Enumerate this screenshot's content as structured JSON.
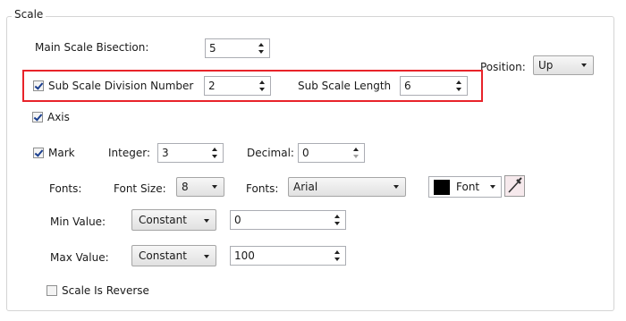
{
  "group": {
    "title": "Scale"
  },
  "main_scale": {
    "label": "Main Scale Bisection:",
    "value": "5"
  },
  "position": {
    "label": "Position:",
    "value": "Up"
  },
  "sub_scale": {
    "label": "Sub Scale Division Number",
    "value": "2",
    "checked": true
  },
  "sub_length": {
    "label": "Sub Scale Length",
    "value": "6"
  },
  "axis": {
    "label": "Axis",
    "checked": true
  },
  "mark": {
    "label": "Mark",
    "checked": true,
    "integer_label": "Integer:",
    "integer_value": "3",
    "decimal_label": "Decimal:",
    "decimal_value": "0"
  },
  "fonts_row": {
    "label": "Fonts:",
    "size_label": "Font Size:",
    "size_value": "8",
    "family_label": "Fonts:",
    "family_value": "Arial",
    "font_button_label": "Font",
    "font_color": "#000000"
  },
  "min_value": {
    "label": "Min Value:",
    "mode": "Constant",
    "value": "0"
  },
  "max_value": {
    "label": "Max Value:",
    "mode": "Constant",
    "value": "100"
  },
  "reverse": {
    "label": "Scale Is Reverse",
    "checked": false
  },
  "colors": {
    "highlight": "#e8232a",
    "check": "#1b3f8f"
  }
}
